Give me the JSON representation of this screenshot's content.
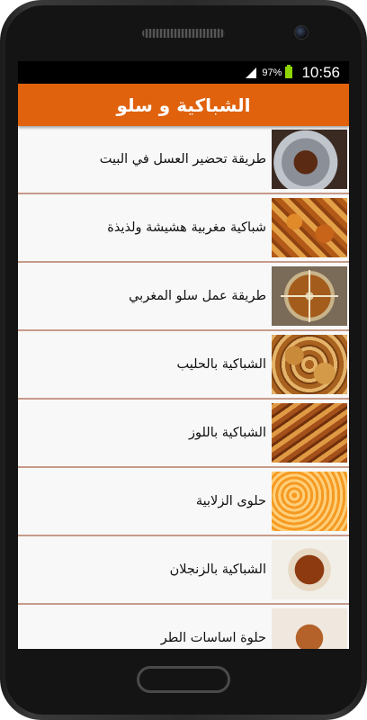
{
  "status_bar": {
    "battery_percent": "97%",
    "time": "10:56"
  },
  "app_bar": {
    "title": "الشباكية و سلو"
  },
  "list": {
    "items": [
      {
        "label": "طريقة تحضير العسل في البيت",
        "thumbnail": "honey-pot"
      },
      {
        "label": "شباكية مغربية هشيشة ولذيذة",
        "thumbnail": "chebakia"
      },
      {
        "label": "طريقة عمل سلو المغربي",
        "thumbnail": "sellou"
      },
      {
        "label": "الشباكية بالحليب",
        "thumbnail": "chebakia-milk"
      },
      {
        "label": "الشباكية باللوز",
        "thumbnail": "chebakia-almond"
      },
      {
        "label": "حلوى الزلابية",
        "thumbnail": "zalabia"
      },
      {
        "label": "الشباكية بالزنجلان",
        "thumbnail": "chebakia-sesame"
      },
      {
        "label": "حلوة اساسات الطر",
        "thumbnail": "sweet"
      }
    ]
  }
}
